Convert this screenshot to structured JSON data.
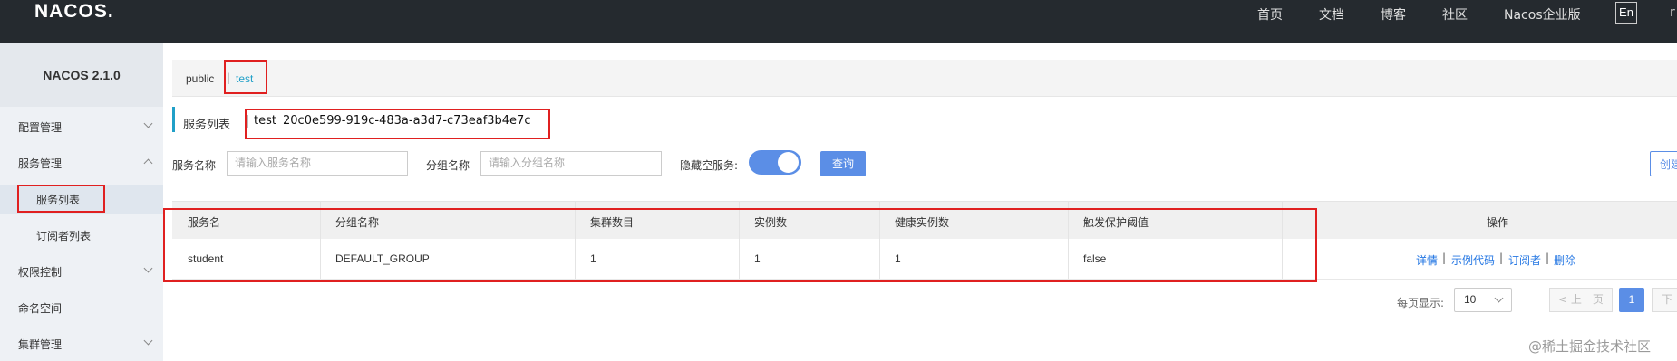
{
  "topbar": {
    "logo": "NACOS.",
    "nav": [
      "首页",
      "文档",
      "博客",
      "社区",
      "Nacos企业版"
    ],
    "lang": "En",
    "extra": "r"
  },
  "sidebar": {
    "version": "NACOS 2.1.0",
    "menu": [
      {
        "label": "配置管理"
      },
      {
        "label": "服务管理"
      },
      {
        "label": "服务列表"
      },
      {
        "label": "订阅者列表"
      },
      {
        "label": "权限控制"
      },
      {
        "label": "命名空间"
      },
      {
        "label": "集群管理"
      }
    ]
  },
  "namespace": {
    "public": "public",
    "separator": "|",
    "test": "test"
  },
  "page": {
    "title": "服务列表",
    "ns_name": "test",
    "ns_id": "20c0e599-919c-483a-a3d7-c73eaf3b4e7c"
  },
  "filters": {
    "service_name_label": "服务名称",
    "service_name_placeholder": "请输入服务名称",
    "group_name_label": "分组名称",
    "group_name_placeholder": "请输入分组名称",
    "hide_empty_label": "隐藏空服务:",
    "query_label": "查询",
    "create_label": "创建"
  },
  "table": {
    "headers": [
      "服务名",
      "分组名称",
      "集群数目",
      "实例数",
      "健康实例数",
      "触发保护阈值",
      "操作"
    ],
    "rows": [
      [
        "student",
        "DEFAULT_GROUP",
        "1",
        "1",
        "1",
        "false"
      ]
    ],
    "ops": [
      "详情",
      "示例代码",
      "订阅者",
      "删除"
    ],
    "op_sep": "|"
  },
  "pagination": {
    "label": "每页显示:",
    "page_size": "10",
    "prev": "< 上一页",
    "current": "1",
    "next": "下一"
  },
  "watermark": "@稀土掘金技术社区",
  "colors": {
    "topbar": "#252a2f",
    "accent": "#20a0c8",
    "primary": "#5b8ee6",
    "annotation": "#e02020"
  }
}
